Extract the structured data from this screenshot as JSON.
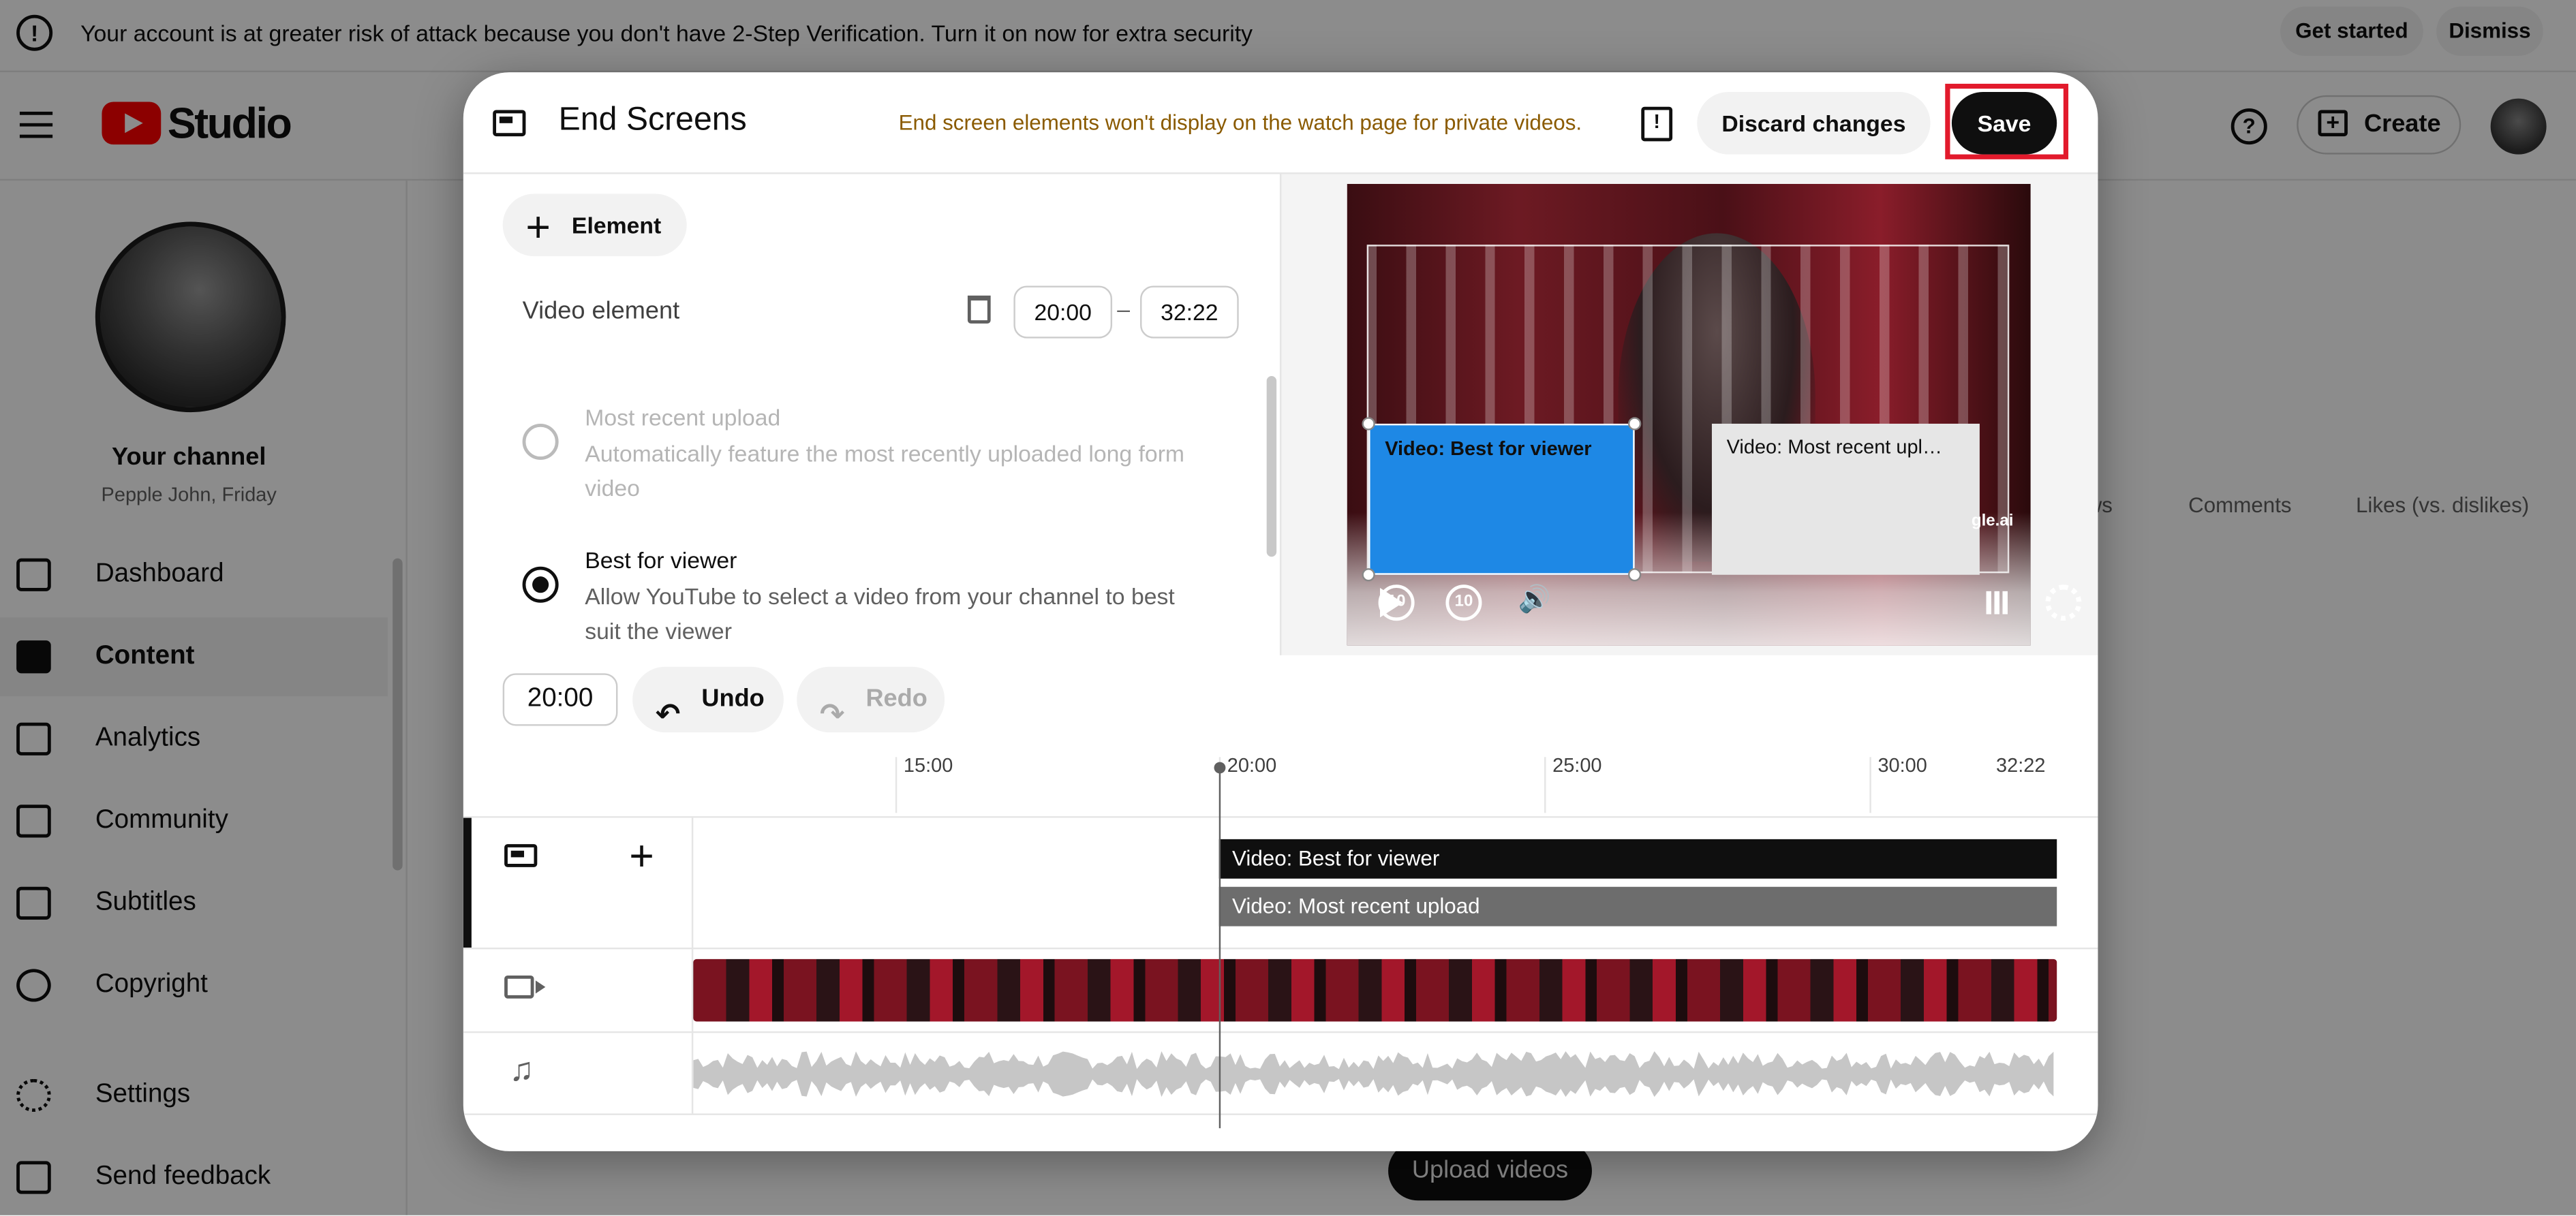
{
  "banner": {
    "message": "Your account is at greater risk of attack because you don't have 2-Step Verification. Turn it on now for extra security",
    "get_started": "Get started",
    "dismiss": "Dismiss"
  },
  "topbar": {
    "logo_text": "Studio",
    "create_label": "Create"
  },
  "sidebar": {
    "channel_name": "Your channel",
    "channel_sub": "Pepple John, Friday",
    "items": [
      {
        "label": "Dashboard",
        "icon": "dashboard-icon",
        "active": false
      },
      {
        "label": "Content",
        "icon": "content-icon",
        "active": true
      },
      {
        "label": "Analytics",
        "icon": "analytics-icon",
        "active": false
      },
      {
        "label": "Community",
        "icon": "community-icon",
        "active": false
      },
      {
        "label": "Subtitles",
        "icon": "subtitles-icon",
        "active": false
      },
      {
        "label": "Copyright",
        "icon": "copyright-icon",
        "active": false
      },
      {
        "label": "Settings",
        "icon": "gear-icon",
        "active": false
      },
      {
        "label": "Send feedback",
        "icon": "feedback-icon",
        "active": false
      }
    ]
  },
  "content": {
    "col_views": "ws",
    "col_comments": "Comments",
    "col_likes": "Likes (vs. dislikes)",
    "upload_videos": "Upload videos"
  },
  "dialog": {
    "title": "End Screens",
    "private_warning": "End screen elements won't display on the watch page for private videos.",
    "discard_label": "Discard changes",
    "save_label": "Save",
    "add_element_label": "Element",
    "video_element_label": "Video element",
    "start_time": "20:00",
    "end_time": "32:22",
    "dash": "–",
    "options": [
      {
        "title": "Most recent upload",
        "desc": "Automatically feature the most recently uploaded long form video",
        "selected": false
      },
      {
        "title": "Best for viewer",
        "desc": "Allow YouTube to select a video from your channel to best suit the viewer",
        "selected": true
      }
    ],
    "preview": {
      "best_label": "Video: Best for viewer",
      "recent_label": "Video: Most recent upl…",
      "watermark": "gle.ai",
      "rewind_label": "10",
      "forward_label": "10"
    },
    "current_time": "20:00",
    "undo_label": "Undo",
    "redo_label": "Redo",
    "ruler": [
      "15:00",
      "20:00",
      "25:00",
      "30:00",
      "32:22"
    ],
    "tracks": {
      "best_clip": "Video: Best for viewer",
      "recent_clip": "Video: Most recent upload"
    }
  },
  "colors": {
    "accent": "#0f0f0f",
    "save_highlight": "#e21a2c",
    "best_element": "#1e88e5",
    "warning_text": "#8a5a00"
  }
}
